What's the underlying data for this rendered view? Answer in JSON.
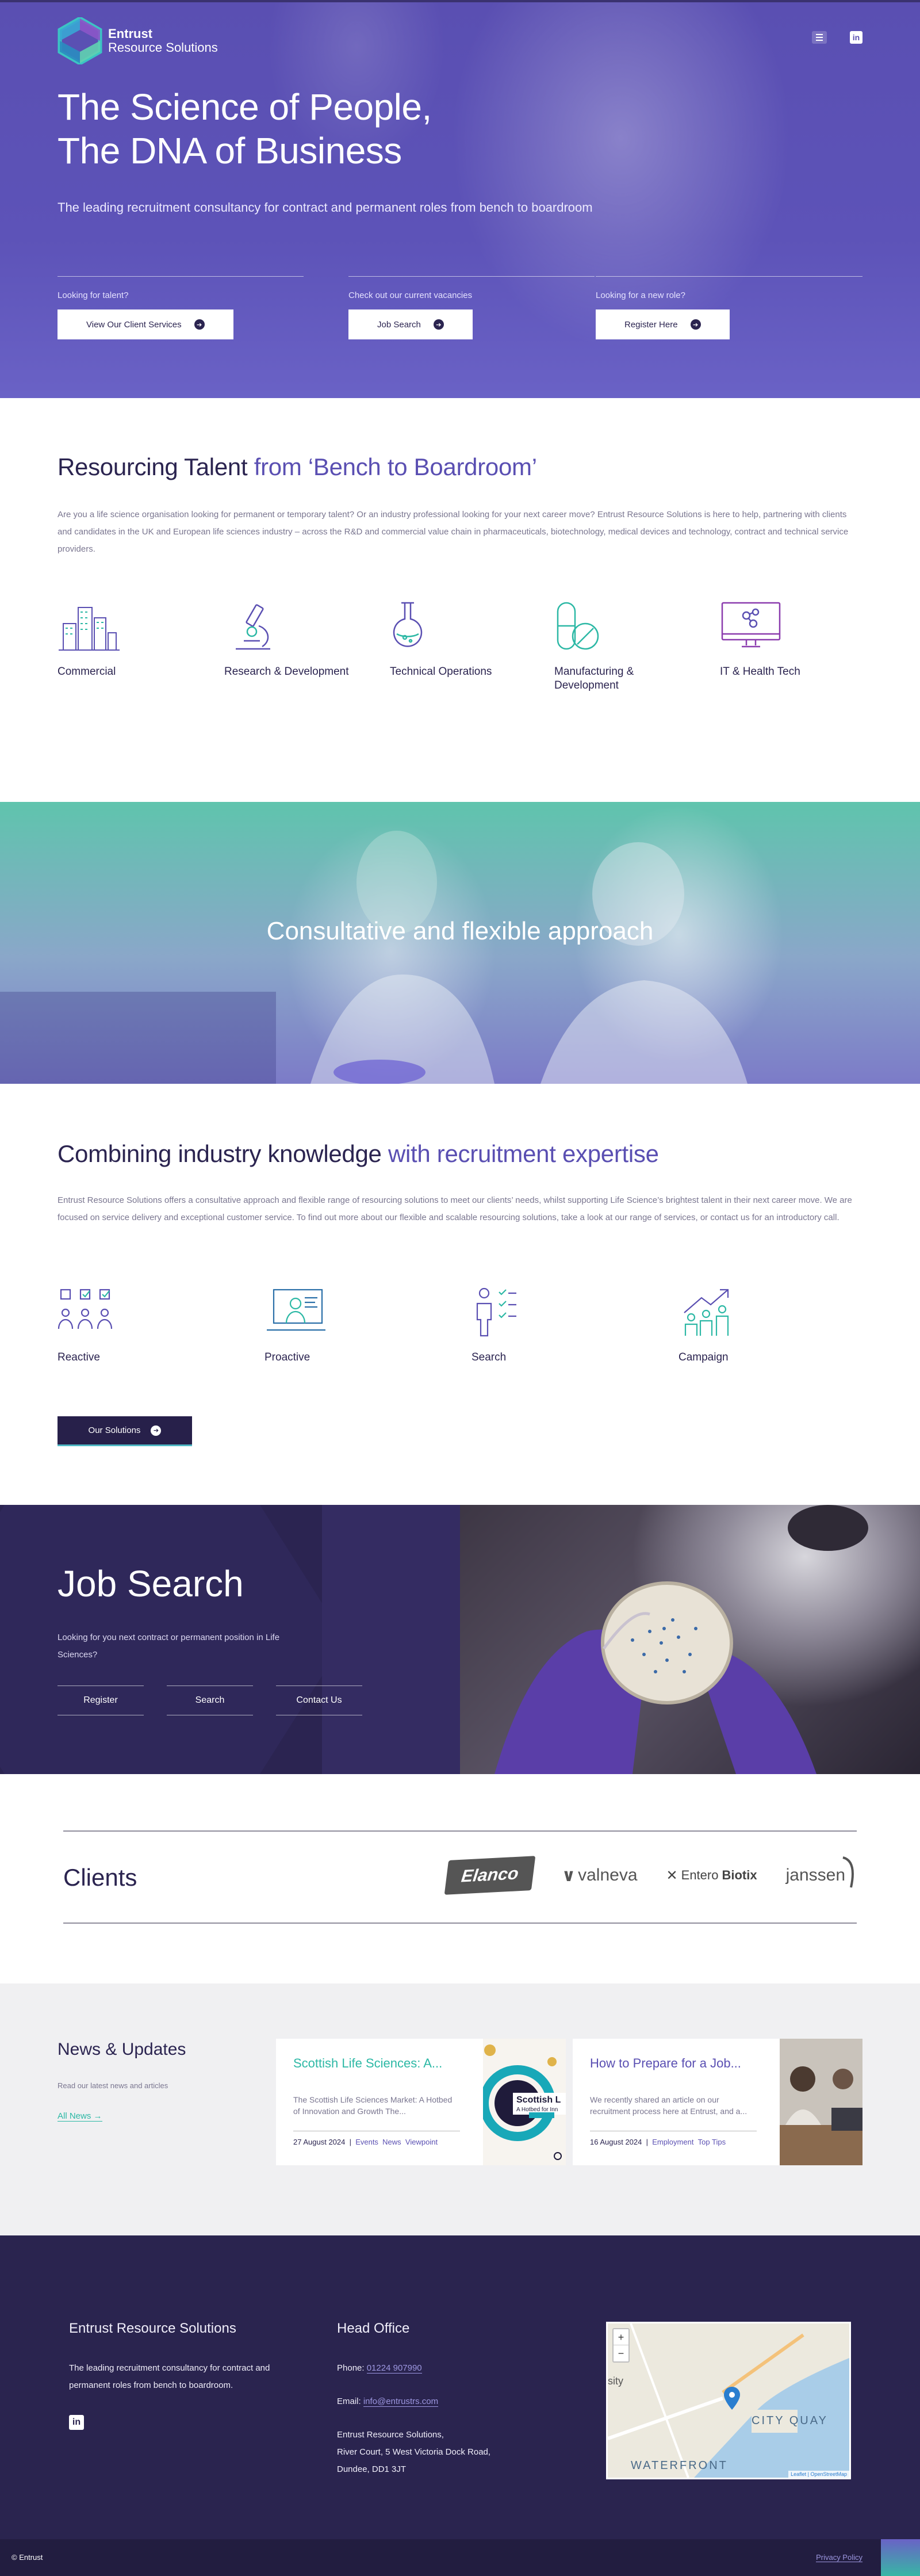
{
  "brand": {
    "name_line1": "Entrust",
    "name_line2": "Resource Solutions"
  },
  "header": {
    "menu_icon": "hamburger-icon",
    "social_icon": "linkedin-icon",
    "linkedin_label": "in"
  },
  "hero": {
    "title_line1": "The Science of People,",
    "title_line2": "The DNA of Business",
    "subtitle": "The leading recruitment consultancy for contract and permanent roles from bench to boardroom",
    "ctas": [
      {
        "label": "Looking for talent?",
        "button": "View Our Client Services"
      },
      {
        "label": "Check out our current vacancies",
        "button": "Job Search"
      },
      {
        "label": "Looking for a new role?",
        "button": "Register Here"
      }
    ]
  },
  "resourcing": {
    "title": "Resourcing Talent ",
    "title_accent": "from ‘Bench to Boardroom’",
    "paragraph": "Are you a life science organisation looking for permanent or temporary talent? Or an industry professional looking for your next career move? Entrust Resource Solutions is here to help, partnering with clients and candidates in the UK and European life sciences industry – across the R&D and commercial value chain in pharmaceuticals, biotechnology, medical devices and technology, contract and technical service providers.",
    "sectors": [
      {
        "name": "Commercial",
        "icon": "buildings-icon"
      },
      {
        "name": "Research & Development",
        "icon": "microscope-icon"
      },
      {
        "name": "Technical Operations",
        "icon": "flask-icon"
      },
      {
        "name": "Manufacturing & Development",
        "icon": "capsule-icon"
      },
      {
        "name": "IT & Health Tech",
        "icon": "monitor-icon"
      }
    ]
  },
  "banner": {
    "title": "Consultative and flexible approach"
  },
  "expertise": {
    "title": "Combining industry knowledge ",
    "title_accent": "with recruitment expertise",
    "paragraph": "Entrust Resource Solutions offers a consultative approach and flexible range of resourcing solutions to meet our clients’ needs, whilst supporting Life Science’s brightest talent in their next career move. We are focused on service delivery and exceptional customer service. To find out more about our flexible and scalable resourcing solutions, take a look at our range of services, or contact us for an introductory call.",
    "services": [
      {
        "name": "Reactive",
        "icon": "team-checklist-icon"
      },
      {
        "name": "Proactive",
        "icon": "presentation-icon"
      },
      {
        "name": "Search",
        "icon": "person-checklist-icon"
      },
      {
        "name": "Campaign",
        "icon": "growth-people-icon"
      }
    ],
    "button": "Our Solutions"
  },
  "job_search": {
    "title": "Job Search",
    "description": "Looking for you next contract or permanent position in Life Sciences?",
    "links": [
      "Register",
      "Search",
      "Contact Us"
    ]
  },
  "clients": {
    "title": "Clients",
    "logos": [
      {
        "name": "Elanco"
      },
      {
        "name": "valneva"
      },
      {
        "name": "Entero",
        "bold": "Biotix"
      },
      {
        "name": "janssen"
      }
    ]
  },
  "news": {
    "title": "News & Updates",
    "subtitle": "Read our latest news and articles",
    "all_link": "All News →",
    "articles": [
      {
        "title": "Scottish Life Sciences: A...",
        "excerpt": "The Scottish Life Sciences Market: A Hotbed of Innovation and Growth The...",
        "date": "27 August 2024",
        "tags": [
          "Events",
          "News",
          "Viewpoint"
        ],
        "thumb_text": "Scottish L",
        "thumb_sub": "A Hotbed for Inn"
      },
      {
        "title": "How to Prepare for a Job...",
        "excerpt": "We recently shared an article on our recruitment process here at Entrust, and a...",
        "date": "16 August 2024",
        "tags": [
          "Employment",
          "Top Tips"
        ]
      }
    ]
  },
  "footer": {
    "company": "Entrust Resource Solutions",
    "tagline": "The leading recruitment consultancy for contract and permanent roles from bench to boardroom.",
    "linkedin_label": "in",
    "office_title": "Head Office",
    "phone_label": "Phone: ",
    "phone": "01224 907990",
    "email_label": "Email: ",
    "email": "info@entrustrs.com",
    "address": [
      "Entrust Resource Solutions,",
      "River Court, 5 West Victoria Dock Road,",
      "Dundee, DD1 3JT"
    ],
    "map": {
      "zoom_in": "+",
      "zoom_out": "−",
      "labels": [
        "sity",
        "CITY QUAY",
        "WATERFRONT"
      ],
      "attribution": "Leaflet | OpenStreetMap"
    },
    "copyright": "© Entrust",
    "privacy": "Privacy Policy"
  },
  "colors": {
    "primary": "#5a4fb2",
    "dark": "#2a244f",
    "teal": "#2cb8a5"
  }
}
